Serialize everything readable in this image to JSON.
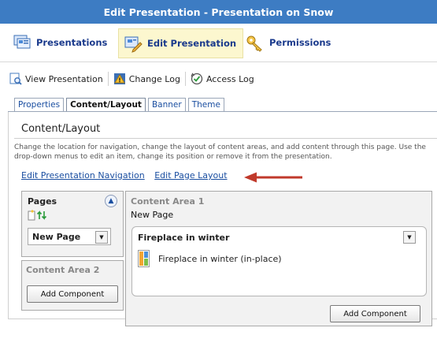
{
  "window": {
    "title": "Edit Presentation - Presentation on Snow"
  },
  "main_nav": {
    "presentations": "Presentations",
    "edit_presentation": "Edit Presentation",
    "permissions": "Permissions"
  },
  "toolbar": {
    "view_presentation": "View Presentation",
    "change_log": "Change Log",
    "access_log": "Access Log"
  },
  "tabs": [
    "Properties",
    "Content/Layout",
    "Banner",
    "Theme"
  ],
  "active_tab": "Content/Layout",
  "section": {
    "title": "Content/Layout",
    "description": "Change the location for navigation, change the layout of content areas, and add content through this page. Use the drop-down menus to edit an item, change its position or remove it from the presentation.",
    "link_navigation": "Edit Presentation Navigation",
    "link_layout": "Edit Page Layout"
  },
  "pages": {
    "title": "Pages",
    "selected_page": "New Page"
  },
  "content_area_2": {
    "title": "Content Area 2",
    "add_button": "Add Component"
  },
  "content_area_1": {
    "title": "Content Area 1",
    "page_name": "New Page",
    "component_title": "Fireplace in winter",
    "component_item": "Fireplace in winter (in-place)",
    "add_button": "Add Component"
  },
  "colors": {
    "title_bar": "#3d7cc3",
    "link": "#1a4ea0",
    "arrow": "#c0392b",
    "highlight": "#fcf7cf"
  },
  "icons": [
    "presentations-icon",
    "edit-presentation-icon",
    "permissions-icon",
    "view-presentation-icon",
    "change-log-icon",
    "access-log-icon",
    "new-page-icon",
    "sort-icon",
    "collapse-icon",
    "dropdown-icon",
    "image-component-icon",
    "red-arrow"
  ]
}
